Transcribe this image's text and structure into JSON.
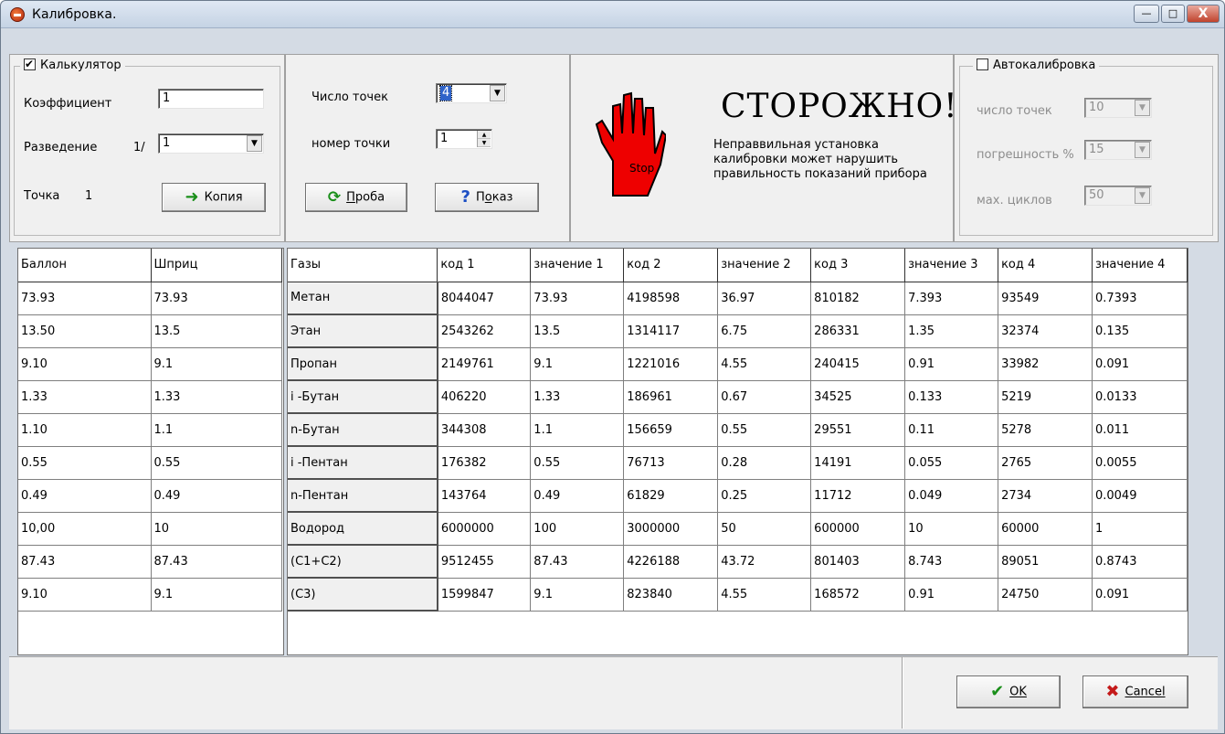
{
  "window": {
    "title": "Калибровка.",
    "controls": {
      "minimize": "—",
      "maximize": "□",
      "close": "X"
    }
  },
  "calculator": {
    "legend": "Калькулятор",
    "checked": true,
    "coef_label": "Коэффициент",
    "coef_value": "1",
    "dilution_label": "Разведение",
    "dilution_prefix": "1/",
    "dilution_value": "1",
    "point_label": "Точка",
    "point_value": "1",
    "copy_button": "Копия"
  },
  "points": {
    "count_label": "Число точек",
    "count_value": "4",
    "number_label": "номер точки",
    "number_value": "1",
    "probe_button": "Проба",
    "show_button": "Показ"
  },
  "warning": {
    "title": "СТОРОЖНО!",
    "text": "Неправвильная установка калибровки может нарушить правильность показаний прибора",
    "hand_label": "Stop"
  },
  "autocal": {
    "legend": "Автокалибровка",
    "checked": false,
    "points_label": "число точек",
    "points_value": "10",
    "error_label": "погрешность %",
    "error_value": "15",
    "cycles_label": "мах. циклов",
    "cycles_value": "50"
  },
  "left_grid": {
    "headers": [
      "Баллон",
      "Шприц"
    ],
    "rows": [
      [
        "73.93",
        "73.93"
      ],
      [
        "13.50",
        "13.5"
      ],
      [
        "9.10",
        "9.1"
      ],
      [
        "1.33",
        "1.33"
      ],
      [
        "1.10",
        "1.1"
      ],
      [
        "0.55",
        "0.55"
      ],
      [
        "0.49",
        "0.49"
      ],
      [
        "10,00",
        "10"
      ],
      [
        "87.43",
        "87.43"
      ],
      [
        "9.10",
        "9.1"
      ]
    ]
  },
  "main_grid": {
    "headers": [
      "Газы",
      "код 1",
      "значение 1",
      "код 2",
      "значение 2",
      "код 3",
      "значение 3",
      "код 4",
      "значение 4"
    ],
    "rows": [
      [
        "Метан",
        "8044047",
        "73.93",
        "4198598",
        "36.97",
        "810182",
        "7.393",
        "93549",
        "0.7393"
      ],
      [
        "Этан",
        "2543262",
        "13.5",
        "1314117",
        "6.75",
        "286331",
        "1.35",
        "32374",
        "0.135"
      ],
      [
        "Пропан",
        "2149761",
        "9.1",
        "1221016",
        "4.55",
        "240415",
        "0.91",
        "33982",
        "0.091"
      ],
      [
        "i -Бутан",
        "406220",
        "1.33",
        "186961",
        "0.67",
        "34525",
        "0.133",
        "5219",
        "0.0133"
      ],
      [
        "n-Бутан",
        "344308",
        "1.1",
        "156659",
        "0.55",
        "29551",
        "0.11",
        "5278",
        "0.011"
      ],
      [
        "i -Пентан",
        "176382",
        "0.55",
        "76713",
        "0.28",
        "14191",
        "0.055",
        "2765",
        "0.0055"
      ],
      [
        "n-Пентан",
        "143764",
        "0.49",
        "61829",
        "0.25",
        "11712",
        "0.049",
        "2734",
        "0.0049"
      ],
      [
        "Водород",
        "6000000",
        "100",
        "3000000",
        "50",
        "600000",
        "10",
        "60000",
        "1"
      ],
      [
        "(C1+C2)",
        "9512455",
        "87.43",
        "4226188",
        "43.72",
        "801403",
        "8.743",
        "89051",
        "0.8743"
      ],
      [
        "(C3)",
        "1599847",
        "9.1",
        "823840",
        "4.55",
        "168572",
        "0.91",
        "24750",
        "0.091"
      ]
    ]
  },
  "footer": {
    "ok_button": "OK",
    "cancel_button": "Cancel"
  }
}
